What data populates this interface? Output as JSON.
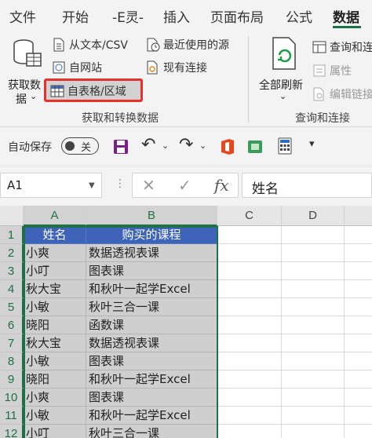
{
  "tabs": [
    "文件",
    "开始",
    "-E灵-",
    "插入",
    "页面布局",
    "公式",
    "数据"
  ],
  "ribbon": {
    "get_data_btn_line1": "获取数",
    "get_data_btn_line2": "据",
    "from_text_csv": "从文本/CSV",
    "from_web": "自网站",
    "from_table_range": "自表格/区域",
    "recent_sources": "最近使用的源",
    "existing_connections": "现有连接",
    "group_get_transform": "获取和转换数据",
    "refresh_all": "全部刷新",
    "queries_connections": "查询和连接",
    "properties": "属性",
    "edit_links": "编辑链接",
    "group_queries": "查询和连接"
  },
  "qat": {
    "autosave_label": "自动保存",
    "autosave_state": "关"
  },
  "formula_bar": {
    "name_box": "A1",
    "cancel_glyph": "✕",
    "enter_glyph": "✓",
    "fx_glyph": "fx",
    "content": "姓名"
  },
  "grid": {
    "columns": [
      "A",
      "B",
      "C",
      "D"
    ],
    "rows": [
      {
        "num": "1",
        "a": "姓名",
        "b": "购买的课程"
      },
      {
        "num": "2",
        "a": "小爽",
        "b": "数据透视表课"
      },
      {
        "num": "3",
        "a": "小叮",
        "b": "图表课"
      },
      {
        "num": "4",
        "a": "秋大宝",
        "b": "和秋叶一起学Excel"
      },
      {
        "num": "5",
        "a": "小敏",
        "b": "秋叶三合一课"
      },
      {
        "num": "6",
        "a": "晓阳",
        "b": "函数课"
      },
      {
        "num": "7",
        "a": "秋大宝",
        "b": "数据透视表课"
      },
      {
        "num": "8",
        "a": "小敏",
        "b": "图表课"
      },
      {
        "num": "9",
        "a": "晓阳",
        "b": "和秋叶一起学Excel"
      },
      {
        "num": "10",
        "a": "小爽",
        "b": "图表课"
      },
      {
        "num": "11",
        "a": "小敏",
        "b": "和秋叶一起学Excel"
      },
      {
        "num": "12",
        "a": "小叮",
        "b": "秋叶三合一课"
      }
    ]
  },
  "colors": {
    "accent_green": "#1e7145",
    "header_blue": "#3d64b8",
    "highlight_red": "#e5322d"
  }
}
